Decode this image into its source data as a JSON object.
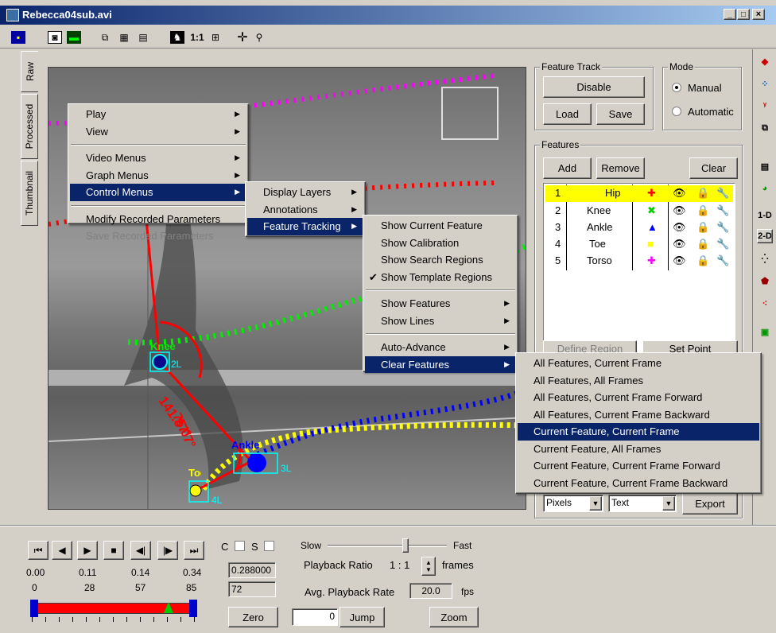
{
  "window": {
    "title": "Rebecca04sub.avi",
    "controls": [
      "_",
      "□",
      "×"
    ]
  },
  "toolbar": {
    "zoom_label": "1:1"
  },
  "side_tabs": [
    "Raw",
    "Processed",
    "Thumbnail"
  ],
  "overlay": {
    "angle1": "141.87°",
    "angle2": "75.07°",
    "labels": {
      "knee": "Knee",
      "knee_id": "2L",
      "ankle": "Ankle",
      "ankle_id": "3L",
      "toe": "Toe",
      "toe_id": "4L"
    }
  },
  "menu1": [
    {
      "label": "Play"
    },
    {
      "label": "View"
    },
    {
      "label": "Video Menus"
    },
    {
      "label": "Graph Menus"
    },
    {
      "label": "Control Menus"
    },
    {
      "label": "Modify Recorded Parameters"
    },
    {
      "label": "Save Recorded Parameters"
    }
  ],
  "menu2": [
    {
      "label": "Display Layers"
    },
    {
      "label": "Annotations"
    },
    {
      "label": "Feature Tracking"
    }
  ],
  "menu3": [
    {
      "label": "Show Current Feature"
    },
    {
      "label": "Show Calibration"
    },
    {
      "label": "Show Search Regions"
    },
    {
      "label": "Show Template Regions",
      "check": "✔"
    },
    {
      "label": "Show Features"
    },
    {
      "label": "Show Lines"
    },
    {
      "label": "Auto-Advance"
    },
    {
      "label": "Clear Features"
    }
  ],
  "menu4": [
    {
      "label": "All Features, Current Frame"
    },
    {
      "label": "All Features, All Frames"
    },
    {
      "label": "All Features, Current Frame Forward"
    },
    {
      "label": "All Features, Current Frame Backward"
    },
    {
      "label": "Current Feature, Current Frame"
    },
    {
      "label": "Current Feature, All Frames"
    },
    {
      "label": "Current Feature, Current Frame Forward"
    },
    {
      "label": "Current Feature, Current Frame Backward"
    }
  ],
  "feature_track": {
    "title": "Feature Track",
    "disable": "Disable",
    "load": "Load",
    "save": "Save"
  },
  "mode": {
    "title": "Mode",
    "manual": "Manual",
    "automatic": "Automatic"
  },
  "features": {
    "title": "Features",
    "add": "Add",
    "remove": "Remove",
    "clear": "Clear",
    "rows": [
      {
        "n": "1",
        "name": "Hip",
        "marker": "✚",
        "color": "#ff0000"
      },
      {
        "n": "2",
        "name": "Knee",
        "marker": "✖",
        "color": "#00cc00"
      },
      {
        "n": "3",
        "name": "Ankle",
        "marker": "▲",
        "color": "#0000ff"
      },
      {
        "n": "4",
        "name": "Toe",
        "marker": "■",
        "color": "#ffff00"
      },
      {
        "n": "5",
        "name": "Torso",
        "marker": "✚",
        "color": "#ff00ff"
      }
    ],
    "define_region": "Define Region",
    "set_point": "Set Point"
  },
  "export": {
    "units": "Pixels",
    "format": "Text",
    "button": "Export"
  },
  "right_toolbar": {
    "one_d": "1-D",
    "two_d": "2-D"
  },
  "playback": {
    "times": [
      "0.00",
      "0.11",
      "0.14",
      "0.34"
    ],
    "frames": [
      "0",
      "28",
      "57",
      "85"
    ],
    "c_label": "C",
    "s_label": "S",
    "slow": "Slow",
    "fast": "Fast",
    "ratio_label": "Playback Ratio",
    "ratio_value": "1 : 1",
    "frames_label": "frames",
    "avg_label": "Avg. Playback Rate",
    "avg_value": "20.0",
    "fps": "fps",
    "time_value": "0.288000",
    "frame_value": "72",
    "zero": "Zero",
    "jump_value": "0",
    "jump": "Jump",
    "zoom": "Zoom"
  }
}
